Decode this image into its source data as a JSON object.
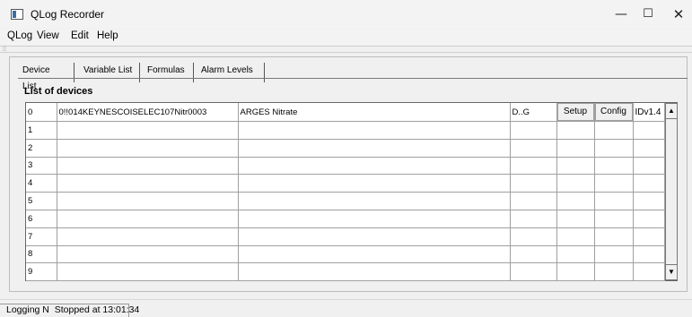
{
  "window": {
    "title": "QLog Recorder",
    "minimize_glyph": "—",
    "maximize_glyph": "☐",
    "close_glyph": "✕"
  },
  "menu": [
    "QLog",
    "View",
    "Edit",
    "Help"
  ],
  "toolbar": {
    "grip": "⁞⁞"
  },
  "tabs": [
    "Device List",
    "Variable List",
    "Formulas",
    "Alarm Levels"
  ],
  "section_title": "List of devices",
  "devices": {
    "rows": [
      {
        "index": "0",
        "address": "0!!014KEYNESCOISELEC107Nitr0003",
        "name": "ARGES Nitrate",
        "dg": "D..G",
        "setup": "Setup",
        "config": "Config",
        "version": "IDv1.4"
      },
      {
        "index": "1",
        "address": "",
        "name": "",
        "dg": "",
        "setup": "",
        "config": "",
        "version": ""
      },
      {
        "index": "2",
        "address": "",
        "name": "",
        "dg": "",
        "setup": "",
        "config": "",
        "version": ""
      },
      {
        "index": "3",
        "address": "",
        "name": "",
        "dg": "",
        "setup": "",
        "config": "",
        "version": ""
      },
      {
        "index": "4",
        "address": "",
        "name": "",
        "dg": "",
        "setup": "",
        "config": "",
        "version": ""
      },
      {
        "index": "5",
        "address": "",
        "name": "",
        "dg": "",
        "setup": "",
        "config": "",
        "version": ""
      },
      {
        "index": "6",
        "address": "",
        "name": "",
        "dg": "",
        "setup": "",
        "config": "",
        "version": ""
      },
      {
        "index": "7",
        "address": "",
        "name": "",
        "dg": "",
        "setup": "",
        "config": "",
        "version": ""
      },
      {
        "index": "8",
        "address": "",
        "name": "",
        "dg": "",
        "setup": "",
        "config": "",
        "version": ""
      },
      {
        "index": "9",
        "address": "",
        "name": "",
        "dg": "",
        "setup": "",
        "config": "",
        "version": ""
      }
    ]
  },
  "scrollbar": {
    "up_arrow": "▲",
    "down_arrow": "▼"
  },
  "status": {
    "logging": "Logging N",
    "state": "Stopped at 13:01:34"
  }
}
